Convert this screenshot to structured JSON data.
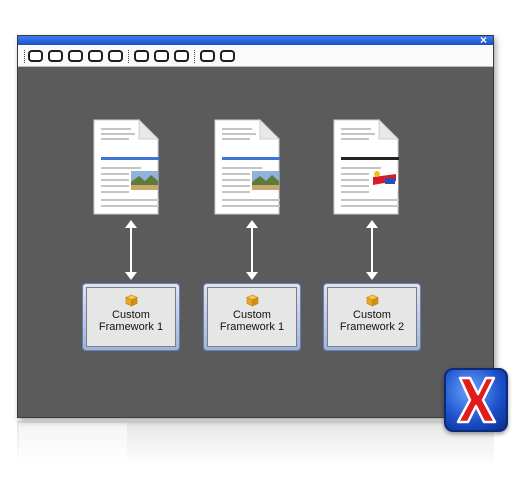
{
  "window": {
    "close_glyph": "×",
    "toolbar_buttons": 9
  },
  "frameworks": [
    {
      "label_line1": "Custom",
      "label_line2": "Framework 1",
      "icon": "package-icon"
    },
    {
      "label_line1": "Custom",
      "label_line2": "Framework 1",
      "icon": "package-icon"
    },
    {
      "label_line1": "Custom",
      "label_line2": "Framework 2",
      "icon": "package-icon"
    }
  ],
  "documents": [
    {
      "icon": "document-icon",
      "accent": "#3c74d8",
      "image": "landscape"
    },
    {
      "icon": "document-icon",
      "accent": "#3c74d8",
      "image": "landscape"
    },
    {
      "icon": "document-icon",
      "accent": "#222222",
      "image": "flag-chart"
    }
  ],
  "colors": {
    "titlebar": "#1f5ad8",
    "canvas": "#5b5b5b",
    "framework_border": "#6b7fae"
  },
  "logo": {
    "name": "oxygen-x-logo"
  }
}
